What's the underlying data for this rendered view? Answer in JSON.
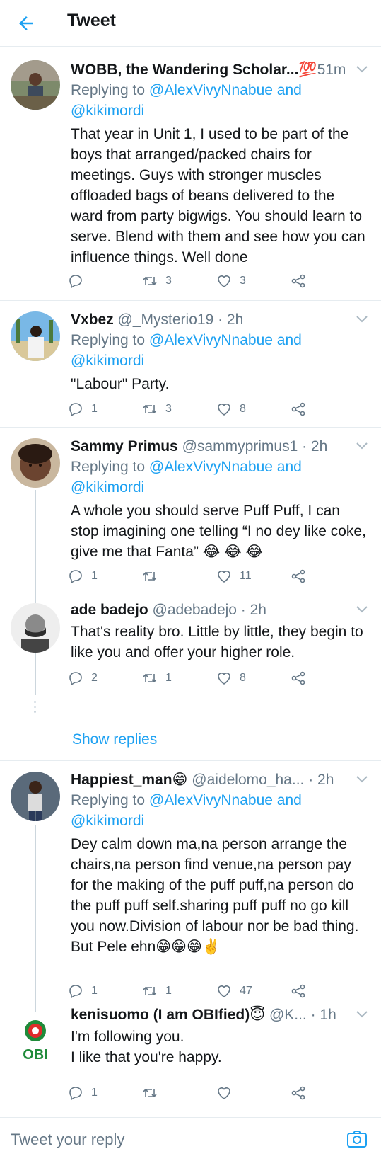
{
  "header": {
    "title": "Tweet"
  },
  "tweets": [
    {
      "name": "WOBB, the Wandering Scholar...💯",
      "handle": "",
      "time": "51m",
      "replying_prefix": "Replying to ",
      "replying_to": "@AlexVivyNnabue and",
      "replying_to2": "@kikimordi",
      "text": "That year in Unit 1, I used to be part of the boys that arranged/packed chairs for meetings. Guys with stronger muscles offloaded bags of beans delivered to the ward from party bigwigs. You should learn to serve. Blend with them and see how you can influence things. Well done",
      "replies": "",
      "retweets": "3",
      "likes": "3"
    },
    {
      "name": "Vxbez",
      "handle": "@_Mysterio19 · 2h",
      "replying_prefix": "Replying to ",
      "replying_to": "@AlexVivyNnabue and",
      "replying_to2": "@kikimordi",
      "text": "\"Labour\" Party.",
      "replies": "1",
      "retweets": "3",
      "likes": "8"
    },
    {
      "name": "Sammy Primus",
      "handle": "@sammyprimus1 · 2h",
      "replying_prefix": "Replying to ",
      "replying_to": "@AlexVivyNnabue and",
      "replying_to2": "@kikimordi",
      "text": "A whole you should serve Puff Puff, I can stop imagining one telling “I no dey like coke, give me that Fanta” 😂 😂 😂",
      "replies": "1",
      "retweets": "",
      "likes": "11"
    },
    {
      "name": "ade badejo",
      "handle": "@adebadejo · 2h",
      "text": "That's reality bro. Little by little, they begin to like you and offer your higher role.",
      "replies": "2",
      "retweets": "1",
      "likes": "8"
    },
    {
      "name": "Happiest_man😁",
      "handle": "@aidelomo_ha... · 2h",
      "replying_prefix": "Replying to ",
      "replying_to": "@AlexVivyNnabue and",
      "replying_to2": "@kikimordi",
      "text": "Dey calm down ma,na person arrange the chairs,na person find venue,na person pay for the making of the puff puff,na person do the puff puff self.sharing puff puff no go kill you now.Division of labour nor be bad thing. But Pele ehn😁😁😁✌️",
      "replies": "1",
      "retweets": "1",
      "likes": "47"
    },
    {
      "name": "kenisuomo (I am OBIfied)😇",
      "handle": "@K... · 1h",
      "text": "I'm following you.\nI like that you're happy.",
      "replies": "1",
      "retweets": "",
      "likes": ""
    }
  ],
  "show_replies": "Show replies",
  "obi_logo_text": "OBI",
  "composer": {
    "placeholder": "Tweet your reply"
  },
  "colors": {
    "accent": "#1da1f2",
    "muted": "#657786",
    "text": "#14171a",
    "border": "#e6ecf0"
  },
  "icons": [
    "back-arrow-icon",
    "chevron-down-icon",
    "reply-icon",
    "retweet-icon",
    "like-icon",
    "share-icon",
    "camera-icon"
  ]
}
